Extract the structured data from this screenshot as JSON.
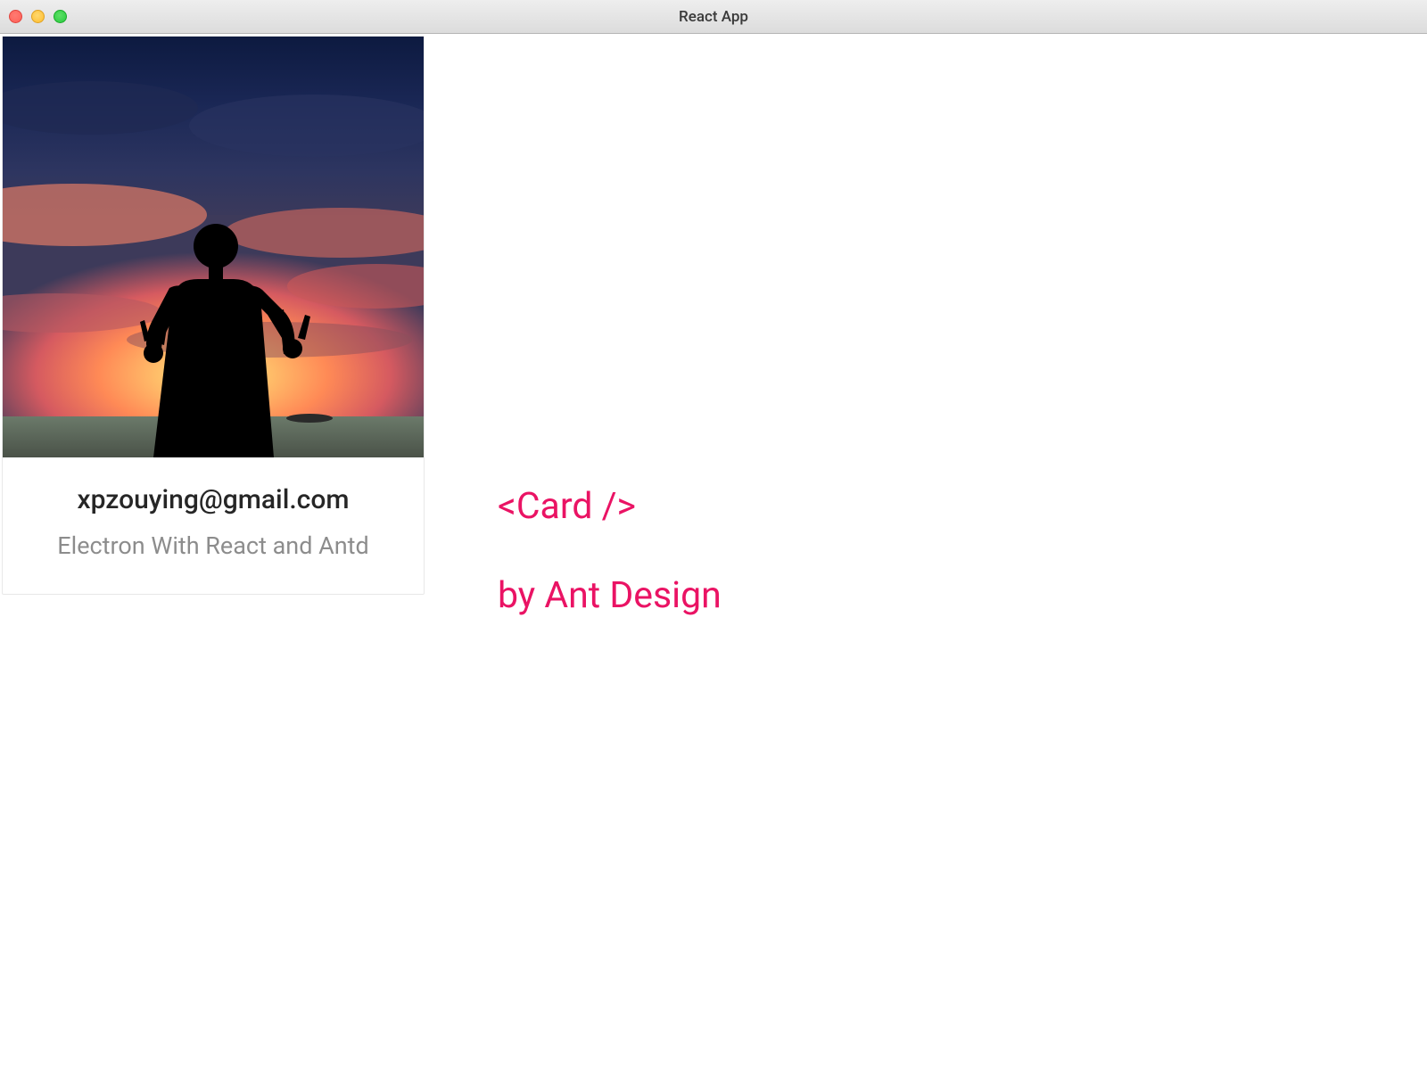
{
  "window": {
    "title": "React App"
  },
  "card": {
    "title": "xpzouying@gmail.com",
    "description": "Electron With React and Antd"
  },
  "sideText": {
    "line1": "<Card />",
    "line2": "by Ant Design"
  },
  "colors": {
    "accent": "#ea1364"
  }
}
